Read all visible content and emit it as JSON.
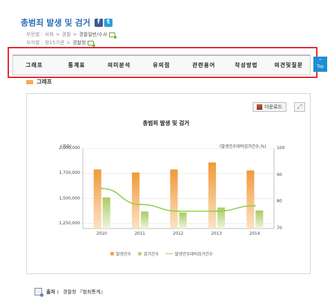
{
  "page": {
    "title": "총범죄 발생 및 검거",
    "sns": {
      "facebook": "f",
      "twitter": "t"
    }
  },
  "meta": {
    "category_label": "부문별 :",
    "category_path": [
      "사회",
      "경찰",
      "경찰일반/수사"
    ],
    "ministry_label": "부처별 :",
    "ministry_path": [
      "정15기관",
      "경찰청"
    ]
  },
  "tabs": [
    "그래프",
    "통계표",
    "의미분석",
    "유의점",
    "관련용어",
    "작성방법",
    "의견및질문"
  ],
  "top_button": {
    "line1": "^",
    "line2": "Top"
  },
  "section": {
    "label": "그래프"
  },
  "toolbar": {
    "download_label": "다운로드"
  },
  "chart_data": {
    "type": "bar",
    "title": "총범죄 발생 및 검거",
    "left_unit": "(건수)",
    "right_unit": "(발생건수대비검거건수,%)",
    "categories": [
      "2010",
      "2011",
      "2012",
      "2013",
      "2014"
    ],
    "left_ticks": [
      "2,000,000",
      "1,750,000",
      "1,500,000",
      "1,250,000"
    ],
    "right_ticks": [
      "100",
      "90",
      "80",
      "70"
    ],
    "ylim": [
      1200000,
      2000000
    ],
    "y2lim": [
      70,
      100
    ],
    "series": [
      {
        "name": "발생건수",
        "type": "bar",
        "axis": "left",
        "values": [
          1790000,
          1760000,
          1790000,
          1860000,
          1780000
        ]
      },
      {
        "name": "검거건수",
        "type": "bar",
        "axis": "left",
        "values": [
          1510000,
          1370000,
          1360000,
          1410000,
          1380000
        ]
      },
      {
        "name": "발생건수대비검거건수",
        "type": "line",
        "axis": "right",
        "values": [
          85.0,
          79.0,
          76.5,
          76.5,
          78.5
        ]
      }
    ],
    "colors": {
      "bar1": "#f2a24a",
      "bar2": "#b9d67a",
      "line": "#8cd04a"
    },
    "grid": true,
    "legend": "bottom"
  },
  "source": {
    "label": "출처 :",
    "text": "경찰청 『범죄통계』"
  }
}
